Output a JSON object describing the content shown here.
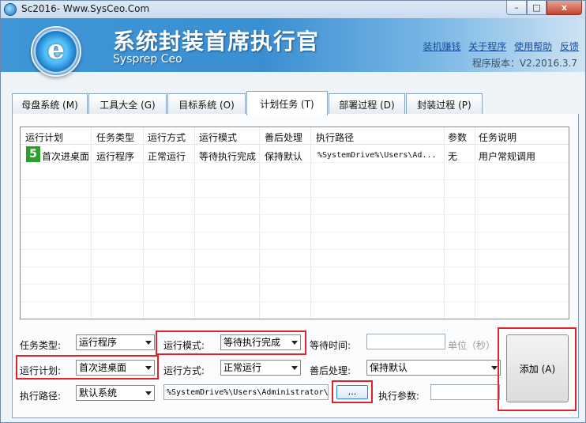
{
  "window": {
    "title": "Sc2016- Www.SysCeo.Com",
    "controls": {
      "minimize": "–",
      "maximize": "□",
      "close": "x"
    }
  },
  "banner": {
    "logo_letter": "e",
    "title_cn": "系统封装首席执行官",
    "title_en": "Sysprep  Ceo",
    "links": [
      "装机赚钱",
      "关于程序",
      "使用帮助",
      "反馈"
    ],
    "version": "程序版本：V2.2016.3.7"
  },
  "tabs": [
    {
      "label": "母盘系统 (M)"
    },
    {
      "label": "工具大全 (G)"
    },
    {
      "label": "目标系统 (O)"
    },
    {
      "label": "计划任务 (T)",
      "active": true
    },
    {
      "label": "部署过程 (D)"
    },
    {
      "label": "封装过程 (P)"
    }
  ],
  "task_list": {
    "columns": [
      "运行计划",
      "任务类型",
      "运行方式",
      "运行模式",
      "善后处理",
      "执行路径",
      "参数",
      "任务说明"
    ],
    "rows": [
      {
        "badge": "5",
        "plan": "首次进桌面",
        "type": "运行程序",
        "method": "正常运行",
        "mode": "等待执行完成",
        "after": "保持默认",
        "path": "%SystemDrive%\\Users\\Ad...",
        "param": "无",
        "desc": "用户常规调用"
      }
    ]
  },
  "form": {
    "task_type": {
      "label": "任务类型:",
      "value": "运行程序"
    },
    "run_mode": {
      "label": "运行模式:",
      "value": "等待执行完成"
    },
    "wait_time": {
      "label": "等待时间:",
      "value": "",
      "unit": "单位（秒）"
    },
    "run_plan": {
      "label": "运行计划:",
      "value": "首次进桌面"
    },
    "run_method": {
      "label": "运行方式:",
      "value": "正常运行"
    },
    "after_process": {
      "label": "善后处理:",
      "value": "保持默认"
    },
    "exec_path": {
      "label": "执行路径:",
      "value": "默认系统",
      "path_value": "%SystemDrive%\\Users\\Administrator\\"
    },
    "browse_label": "...",
    "exec_param": {
      "label": "执行参数:",
      "value": ""
    },
    "add_button": "添加 (A)"
  },
  "highlight_color": "#e0242a"
}
